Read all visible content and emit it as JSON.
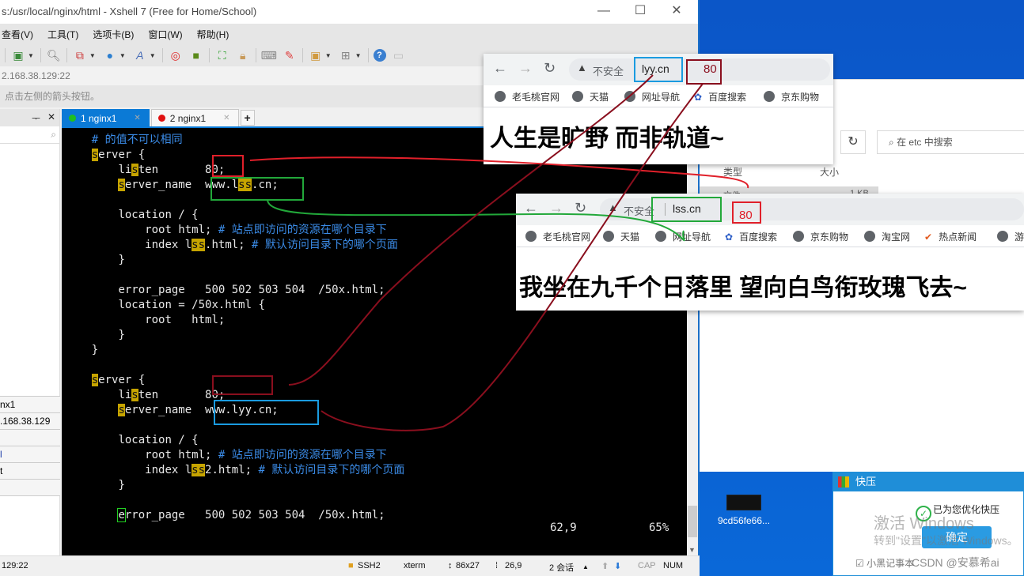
{
  "xshell": {
    "title": "s:/usr/local/nginx/html - Xshell 7 (Free for Home/School)",
    "window_buttons": {
      "minimize": "—",
      "maximize": "☐",
      "close": "✕"
    },
    "menu": [
      "查看(V)",
      "工具(T)",
      "选项卡(B)",
      "窗口(W)",
      "帮助(H)"
    ],
    "toolbar_icons": [
      "session-properties-icon",
      "find-icon",
      "transfer-icon",
      "globe-icon",
      "font-icon",
      "xftp-icon",
      "xmanager-icon",
      "fullscreen-icon",
      "lock-icon",
      "keyboard-icon",
      "highlight-icon",
      "new-folder-icon",
      "layout-icon",
      "help-icon",
      "chat-icon"
    ],
    "address": "2.168.38.129:22",
    "hint": "点击左侧的箭头按钮。",
    "sessions_panel": {
      "pin": "ᅮ",
      "close": "✕",
      "search_icon": "⌕",
      "properties": [
        "nx1",
        ".168.38.129",
        "",
        "l",
        "t",
        ""
      ]
    },
    "tabs": [
      {
        "label": "1 nginx1",
        "dot_color": "#1fbf1f",
        "active": true
      },
      {
        "label": "2 nginx1",
        "dot_color": "#e01010",
        "active": false
      }
    ],
    "tab_add": "+",
    "terminal": {
      "lines": [
        {
          "indent": "    ",
          "parts": [
            {
              "t": "# 的值不可以相同",
              "c": "cm"
            }
          ]
        },
        {
          "indent": "    ",
          "parts": [
            {
              "t": "s",
              "c": "hl"
            },
            {
              "t": "erver {"
            }
          ]
        },
        {
          "indent": "        ",
          "parts": [
            {
              "t": "li"
            },
            {
              "t": "s",
              "c": "hl"
            },
            {
              "t": "ten       80;"
            }
          ]
        },
        {
          "indent": "        ",
          "parts": [
            {
              "t": "s",
              "c": "hl"
            },
            {
              "t": "erver_name  www.l"
            },
            {
              "t": "ss",
              "c": "hl"
            },
            {
              "t": ".cn;"
            }
          ]
        },
        {
          "indent": "",
          "parts": []
        },
        {
          "indent": "        ",
          "parts": [
            {
              "t": "location / {"
            }
          ]
        },
        {
          "indent": "            ",
          "parts": [
            {
              "t": "root html; "
            },
            {
              "t": "# 站点即访问的资源在哪个目录下",
              "c": "cm"
            }
          ]
        },
        {
          "indent": "            ",
          "parts": [
            {
              "t": "index l"
            },
            {
              "t": "ss",
              "c": "hl"
            },
            {
              "t": ".html; "
            },
            {
              "t": "# 默认访问目录下的哪个页面",
              "c": "cm"
            }
          ]
        },
        {
          "indent": "        ",
          "parts": [
            {
              "t": "}"
            }
          ]
        },
        {
          "indent": "",
          "parts": []
        },
        {
          "indent": "        ",
          "parts": [
            {
              "t": "error_page   500 502 503 504  /50x.html;"
            }
          ]
        },
        {
          "indent": "        ",
          "parts": [
            {
              "t": "location = /50x.html {"
            }
          ]
        },
        {
          "indent": "            ",
          "parts": [
            {
              "t": "root   html;"
            }
          ]
        },
        {
          "indent": "        ",
          "parts": [
            {
              "t": "}"
            }
          ]
        },
        {
          "indent": "    ",
          "parts": [
            {
              "t": "}"
            }
          ]
        },
        {
          "indent": "",
          "parts": []
        },
        {
          "indent": "    ",
          "parts": [
            {
              "t": "s",
              "c": "hl"
            },
            {
              "t": "erver {"
            }
          ]
        },
        {
          "indent": "        ",
          "parts": [
            {
              "t": "li"
            },
            {
              "t": "s",
              "c": "hl"
            },
            {
              "t": "ten       80;"
            }
          ]
        },
        {
          "indent": "        ",
          "parts": [
            {
              "t": "s",
              "c": "hl"
            },
            {
              "t": "erver_name  www.lyy.cn;"
            }
          ]
        },
        {
          "indent": "",
          "parts": []
        },
        {
          "indent": "        ",
          "parts": [
            {
              "t": "location / {"
            }
          ]
        },
        {
          "indent": "            ",
          "parts": [
            {
              "t": "root html; "
            },
            {
              "t": "# 站点即访问的资源在哪个目录下",
              "c": "cm"
            }
          ]
        },
        {
          "indent": "            ",
          "parts": [
            {
              "t": "index l"
            },
            {
              "t": "ss",
              "c": "hl"
            },
            {
              "t": "2.html; "
            },
            {
              "t": "# 默认访问目录下的哪个页面",
              "c": "cm"
            }
          ]
        },
        {
          "indent": "        ",
          "parts": [
            {
              "t": "}"
            }
          ]
        },
        {
          "indent": "",
          "parts": []
        },
        {
          "indent": "        ",
          "parts": [
            {
              "t": "e",
              "c": "cur"
            },
            {
              "t": "rror_page   500 502 503 504  /50x.html;"
            }
          ]
        }
      ],
      "cursor_position": "62,9",
      "scroll_percent": "65%"
    },
    "statusbar": {
      "address": "129:22",
      "protocol": "SSH2",
      "term": "xterm",
      "size": "86x27",
      "cursor": "26,9",
      "sessions": "2 会话",
      "cap": "CAP",
      "num": "NUM"
    }
  },
  "browser_lyy": {
    "insecure_label": "不安全",
    "url": "lyy.cn",
    "port_annotation": "80",
    "bookmarks": [
      "老毛桃官网",
      "天猫",
      "网址导航",
      "百度搜索",
      "京东购物"
    ],
    "heading": "人生是旷野 而非轨道~"
  },
  "browser_lss": {
    "insecure_label": "不安全",
    "url": "lss.cn",
    "port_annotation": "80",
    "bookmarks": [
      "老毛桃官网",
      "天猫",
      "网址导航",
      "百度搜索",
      "京东购物",
      "淘宝网",
      "热点新闻",
      "游"
    ],
    "heading": "我坐在九千个日落里 望向白鸟衔玫瑰飞去~"
  },
  "explorer": {
    "search_placeholder": "在 etc 中搜索",
    "columns": [
      "类型",
      "大小"
    ],
    "file_row": {
      "type": "文件",
      "size": "1 KB"
    }
  },
  "desktop": {
    "icon_label": "9cd56fe66..."
  },
  "kuaiya": {
    "title": "快压",
    "message": "已为您优化快压",
    "ok_label": "确定",
    "footer": "☑ 小黑记事本"
  },
  "overlays": {
    "activation_title": "激活 Windows",
    "activation_sub": "转到\"设置\"以激活 Windows。",
    "csdn": "CSDN @安慕希ai"
  },
  "annotation_colors": {
    "red": "#e0202a",
    "green": "#22a83a",
    "blue": "#1a9be0",
    "darkred": "#8a0f1e"
  }
}
